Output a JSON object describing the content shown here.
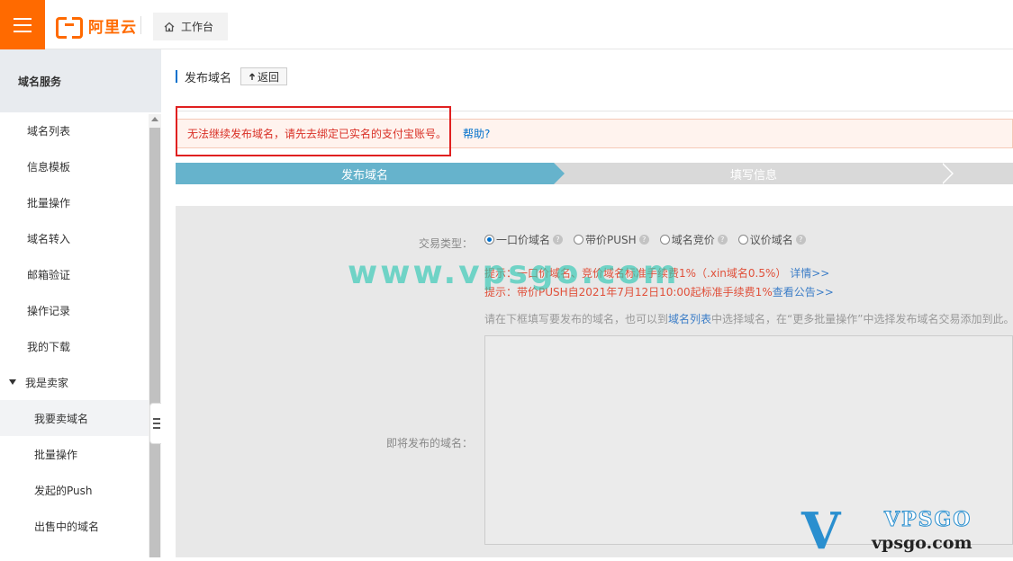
{
  "header": {
    "logo_text": "阿里云",
    "workbench_label": "工作台"
  },
  "sidebar": {
    "title": "域名服务",
    "items": [
      {
        "label": "域名列表"
      },
      {
        "label": "信息模板"
      },
      {
        "label": "批量操作"
      },
      {
        "label": "域名转入"
      },
      {
        "label": "邮箱验证"
      },
      {
        "label": "操作记录"
      },
      {
        "label": "我的下载"
      }
    ],
    "group_label": "我是卖家",
    "sub_items": [
      {
        "label": "我要卖域名",
        "active": true
      },
      {
        "label": "批量操作"
      },
      {
        "label": "发起的Push"
      },
      {
        "label": "出售中的域名"
      }
    ]
  },
  "main": {
    "title": "发布域名",
    "back_label": "返回",
    "alert": {
      "text": "无法继续发布域名，请先去绑定已实名的支付宝账号。",
      "link": "帮助?"
    },
    "steps": [
      "发布域名",
      "填写信息"
    ],
    "form": {
      "type_label": "交易类型：",
      "options": [
        "一口价域名",
        "带价PUSH",
        "域名竞价",
        "议价域名"
      ],
      "selected": "一口价域名",
      "tip1_text": "提示：一口价域名、竞价域名标准手续费1%（.xin域名0.5%）",
      "tip1_link": "详情>>",
      "tip2_text": "提示：带价PUSH自2021年7月12日10:00起标准手续费1%",
      "tip2_link": "查看公告>>",
      "hint_pre": "请在下框填写要发布的域名，也可以到",
      "hint_link": "域名列表",
      "hint_post": "中选择域名，在“更多批量操作”中选择发布域名交易添加到此。",
      "domains_label": "即将发布的域名："
    }
  },
  "watermark": {
    "text": "www.vpsgo.com",
    "logo_letter": "V",
    "logo_brand": "VPSGO",
    "logo_url": "vpsgo.com"
  },
  "colors": {
    "brand": "#ff6a00",
    "alert_text": "#d93026",
    "link": "#0070cc",
    "step_active": "#66b3cc"
  }
}
